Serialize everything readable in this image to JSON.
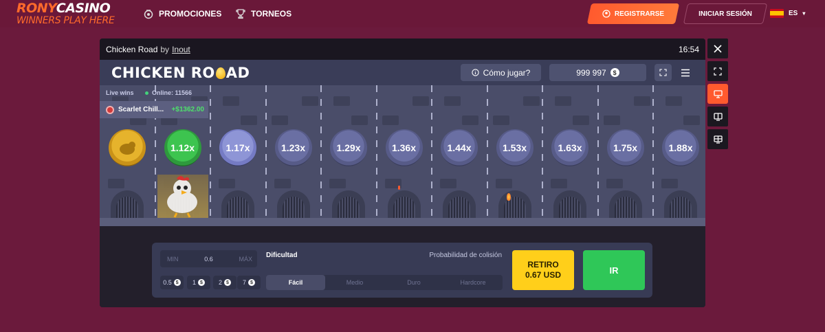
{
  "site": {
    "logo_line1_a": "RONY",
    "logo_line1_b": "CASINO",
    "logo_line2": "WINNERS PLAY HERE",
    "nav": [
      {
        "label": "PROMOCIONES",
        "icon": "promo-badge-icon"
      },
      {
        "label": "TORNEOS",
        "icon": "trophy-icon"
      }
    ],
    "register_label": "REGISTRARSE",
    "login_label": "INICIAR SESIÓN",
    "language": "ES",
    "accent": "#ff5a2e",
    "bg": "#6b1a3c"
  },
  "window": {
    "game_name": "Chicken Road",
    "by_text": "by",
    "provider": "Inout",
    "time": "16:54"
  },
  "game": {
    "title": "CHICKEN RO",
    "title_end": "AD",
    "how_to_play": "Cómo jugar?",
    "balance": "999 997",
    "currency_symbol": "$",
    "live_wins_label": "Live wins",
    "online_label": "Online: 11566",
    "winner_name": "Scarlet Chill...",
    "winner_amount": "+$1362.00",
    "multipliers": [
      "1.12x",
      "1.17x",
      "1.23x",
      "1.29x",
      "1.36x",
      "1.44x",
      "1.53x",
      "1.63x",
      "1.75x",
      "1.88x"
    ]
  },
  "controls": {
    "min_label": "MIN",
    "bet_value": "0.6",
    "max_label": "MÁX",
    "quick_bets": [
      "0.5",
      "1",
      "2",
      "7"
    ],
    "difficulty_label": "Dificultad",
    "collision_label": "Probabilidad de colisión",
    "difficulties": [
      "Fácil",
      "Medio",
      "Duro",
      "Hardcore"
    ],
    "cashout_line1": "RETIRO",
    "cashout_line2": "0.67 USD",
    "go_label": "IR"
  }
}
